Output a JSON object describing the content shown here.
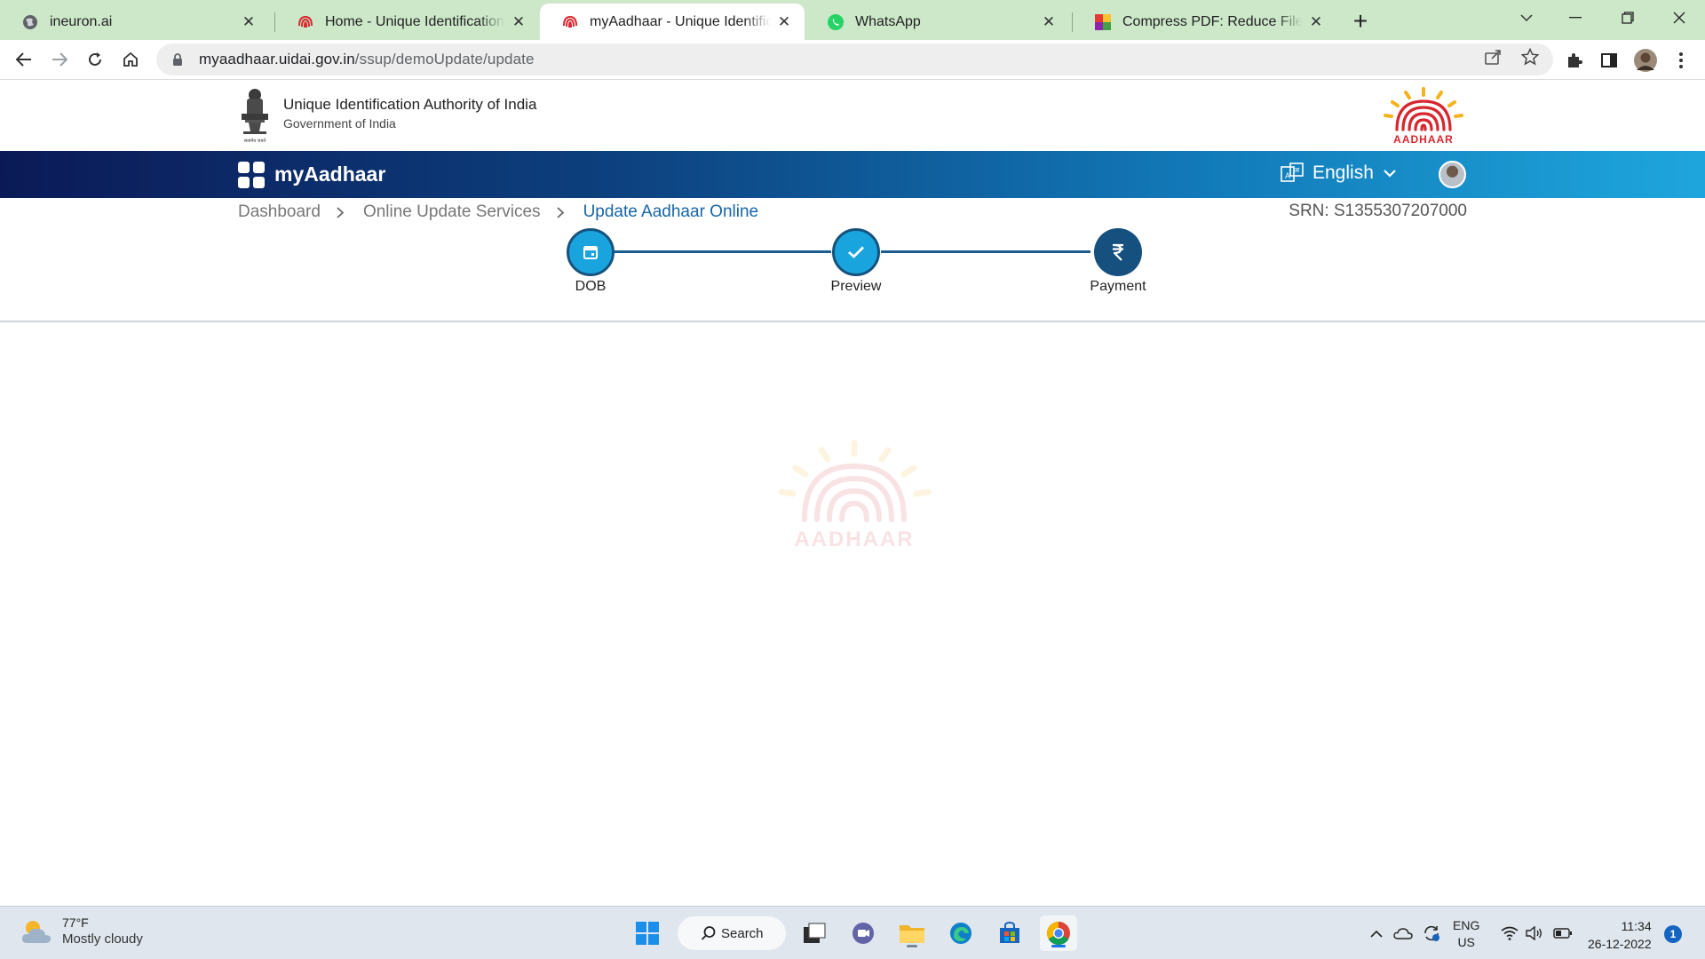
{
  "browser": {
    "tabs": [
      {
        "title": "ineuron.ai",
        "icon": "globe-icon"
      },
      {
        "title": "Home - Unique Identification Authority of India",
        "icon": "aadhaar-fingerprint-icon"
      },
      {
        "title": "myAadhaar - Unique Identification Authority of India",
        "icon": "aadhaar-fingerprint-icon"
      },
      {
        "title": "WhatsApp",
        "icon": "whatsapp-icon"
      },
      {
        "title": "Compress PDF: Reduce File Size Online",
        "icon": "compress-pdf-icon"
      }
    ],
    "active_tab_index": 2,
    "url_host": "myaadhaar.uidai.gov.in",
    "url_path": "/ssup/demoUpdate/update"
  },
  "header": {
    "org_name": "Unique Identification Authority of India",
    "org_sub": "Government of India",
    "emblem_caption": "सत्यमेव जयते",
    "logo_text": "AADHAAR"
  },
  "navbar": {
    "app_name": "myAadhaar",
    "language": "English"
  },
  "breadcrumb": {
    "items": [
      "Dashboard",
      "Online Update Services",
      "Update Aadhaar Online"
    ]
  },
  "srn": "SRN: S1355307207000",
  "stepper": {
    "steps": [
      {
        "label": "DOB",
        "icon": "calendar-icon"
      },
      {
        "label": "Preview",
        "icon": "checkmark-icon"
      },
      {
        "label": "Payment",
        "icon": "rupee-icon"
      }
    ]
  },
  "watermark_text": "AADHAAR",
  "taskbar": {
    "weather_temp": "77°F",
    "weather_desc": "Mostly cloudy",
    "search_label": "Search",
    "lang_line1": "ENG",
    "lang_line2": "US",
    "time": "11:34",
    "date": "26-12-2022",
    "notification_count": "1"
  },
  "colors": {
    "navbar_gradient_start": "#0b1a57",
    "navbar_gradient_end": "#1ea6dc",
    "step_active": "#19a4dd",
    "step_dark": "#16507f",
    "breadcrumb_current": "#1565a8",
    "tabstrip_bg": "#cce8c9"
  }
}
